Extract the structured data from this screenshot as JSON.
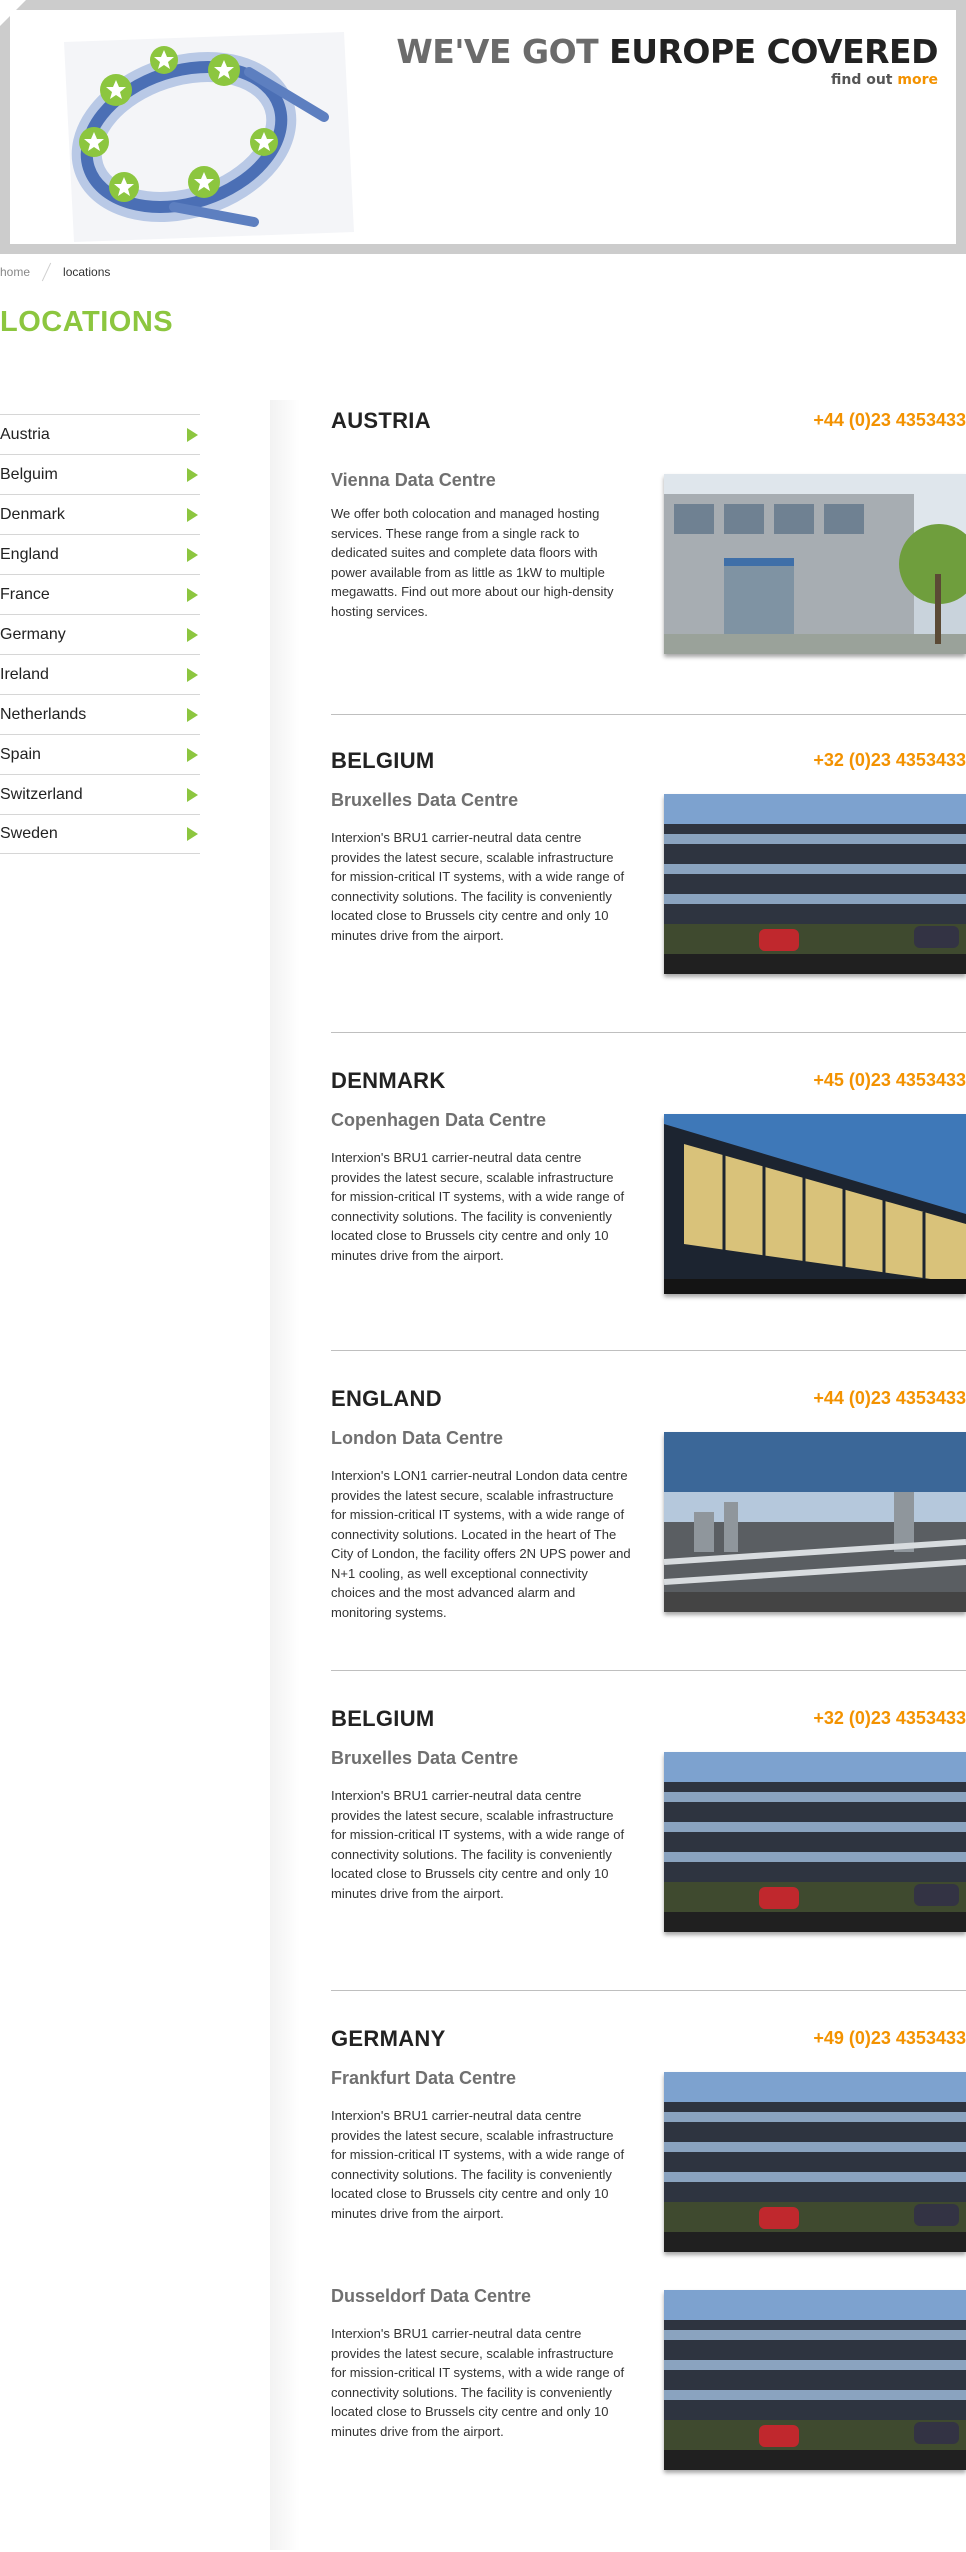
{
  "banner": {
    "title_light": "WE'VE GOT",
    "title_dark": "EUROPE COVERED",
    "sub_text": "find out",
    "sub_link": "more"
  },
  "breadcrumb": {
    "home": "home",
    "current": "locations"
  },
  "page_title": "LOCATIONS",
  "sidebar": {
    "items": [
      {
        "label": "Austria"
      },
      {
        "label": "Belguim"
      },
      {
        "label": "Denmark"
      },
      {
        "label": "England"
      },
      {
        "label": "France"
      },
      {
        "label": "Germany"
      },
      {
        "label": "Ireland"
      },
      {
        "label": "Netherlands"
      },
      {
        "label": "Spain"
      },
      {
        "label": "Switzerland"
      },
      {
        "label": "Sweden"
      }
    ]
  },
  "locations": [
    {
      "country": "AUSTRIA",
      "phone": "+44 (0)23 4353433",
      "centres": [
        {
          "name": "Vienna Data Centre",
          "description": "We offer both colocation and managed hosting services. These range from a single rack to dedicated suites and complete data floors with power available from as little as 1kW to multiple megawatts. Find out more about our high-density hosting services."
        }
      ]
    },
    {
      "country": "BELGIUM",
      "phone": "+32 (0)23 4353433",
      "centres": [
        {
          "name": "Bruxelles Data Centre",
          "description": "Interxion's BRU1 carrier-neutral data centre provides the latest secure, scalable infrastructure for mission-critical IT systems, with a wide range of connectivity solutions. The facility is conveniently located close to Brussels city centre and only 10 minutes drive from the airport."
        }
      ]
    },
    {
      "country": "DENMARK",
      "phone": "+45 (0)23 4353433",
      "centres": [
        {
          "name": "Copenhagen Data Centre",
          "description": "Interxion's BRU1 carrier-neutral data centre provides the latest secure, scalable infrastructure for mission-critical IT systems, with a wide range of connectivity solutions. The facility is conveniently located close to Brussels city centre and only 10 minutes drive from the airport."
        }
      ]
    },
    {
      "country": "ENGLAND",
      "phone": "+44 (0)23 4353433",
      "centres": [
        {
          "name": "London Data Centre",
          "description": "Interxion's LON1 carrier-neutral London data centre provides the latest secure, scalable infrastructure for mission-critical IT systems, with a wide range of connectivity solutions. Located in the heart of The City of London, the facility offers 2N UPS power and N+1 cooling, as well exceptional connectivity choices and the most advanced alarm and monitoring systems."
        }
      ]
    },
    {
      "country": "BELGIUM",
      "phone": "+32 (0)23 4353433",
      "centres": [
        {
          "name": "Bruxelles Data Centre",
          "description": "Interxion's BRU1 carrier-neutral data centre provides the latest secure, scalable infrastructure for mission-critical IT systems, with a wide range of connectivity solutions. The facility is conveniently located close to Brussels city centre and only 10 minutes drive from the airport."
        }
      ]
    },
    {
      "country": "GERMANY",
      "phone": "+49 (0)23 4353433",
      "centres": [
        {
          "name": "Frankfurt Data Centre",
          "description": "Interxion's BRU1 carrier-neutral data centre provides the latest secure, scalable infrastructure for mission-critical IT systems, with a wide range of connectivity solutions. The facility is conveniently located close to Brussels city centre and only 10 minutes drive from the airport."
        },
        {
          "name": "Dusseldorf Data Centre",
          "description": "Interxion's BRU1 carrier-neutral data centre provides the latest secure, scalable infrastructure for mission-critical IT systems, with a wide range of connectivity solutions. The facility is conveniently located close to Brussels city centre and only 10 minutes drive from the airport."
        }
      ]
    }
  ]
}
